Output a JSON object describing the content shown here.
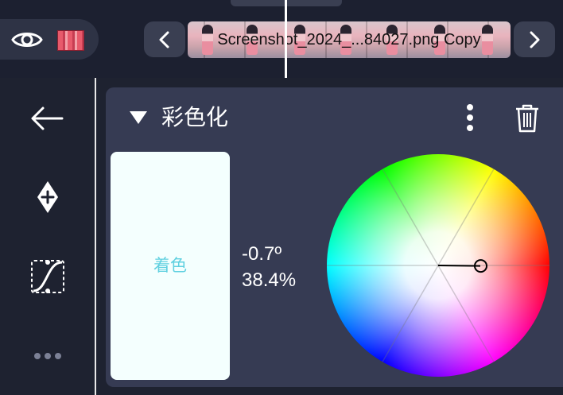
{
  "header": {
    "clip_name": "Screenshot_2024_...84027.png Copy"
  },
  "icons": {
    "visibility": "eye-icon",
    "layer_thumbnail": "layer-thumbnail",
    "previous": "chevron-left-icon",
    "next": "chevron-right-icon",
    "back": "arrow-left-icon",
    "add_keyframe": "add-keyframe-icon",
    "curve": "curve-icon",
    "more_tools": "more-horizontal-icon",
    "collapse": "triangle-down-icon",
    "panel_menu": "more-vertical-icon",
    "delete": "trash-icon"
  },
  "panel": {
    "title": "彩色化",
    "swatch_label": "着色",
    "swatch_color": "#f4fffe",
    "hue": "-0.7º",
    "saturation": "38.4%"
  },
  "colors": {
    "background": "#1e2230",
    "panel": "#363b53",
    "button": "#3a3f52",
    "accent_text": "#5fd0e0"
  }
}
